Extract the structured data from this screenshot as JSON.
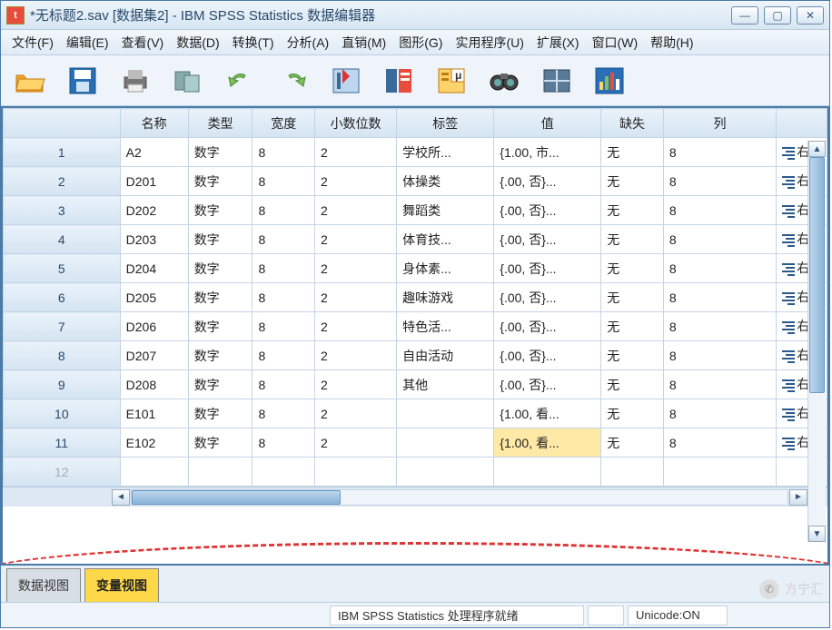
{
  "window": {
    "title": "*无标题2.sav [数据集2] - IBM SPSS Statistics 数据编辑器",
    "min_icon": "—",
    "max_icon": "▢",
    "close_icon": "✕"
  },
  "menu": {
    "file": "文件(F)",
    "edit": "编辑(E)",
    "view": "查看(V)",
    "data": "数据(D)",
    "transform": "转换(T)",
    "analyze": "分析(A)",
    "direct": "直销(M)",
    "graphs": "图形(G)",
    "utilities": "实用程序(U)",
    "extensions": "扩展(X)",
    "window": "窗口(W)",
    "help": "帮助(H)"
  },
  "columns": {
    "name": "名称",
    "type": "类型",
    "width": "宽度",
    "decimals": "小数位数",
    "label": "标签",
    "values": "值",
    "missing": "缺失",
    "col": "列",
    "align": "右"
  },
  "rows": [
    {
      "n": "1",
      "name": "A2",
      "type": "数字",
      "width": "8",
      "dec": "2",
      "label": "学校所...",
      "values": "{1.00, 市...",
      "missing": "无",
      "col": "8",
      "align": "右"
    },
    {
      "n": "2",
      "name": "D201",
      "type": "数字",
      "width": "8",
      "dec": "2",
      "label": "体操类",
      "values": "{.00, 否}...",
      "missing": "无",
      "col": "8",
      "align": "右"
    },
    {
      "n": "3",
      "name": "D202",
      "type": "数字",
      "width": "8",
      "dec": "2",
      "label": "舞蹈类",
      "values": "{.00, 否}...",
      "missing": "无",
      "col": "8",
      "align": "右"
    },
    {
      "n": "4",
      "name": "D203",
      "type": "数字",
      "width": "8",
      "dec": "2",
      "label": "体育技...",
      "values": "{.00, 否}...",
      "missing": "无",
      "col": "8",
      "align": "右"
    },
    {
      "n": "5",
      "name": "D204",
      "type": "数字",
      "width": "8",
      "dec": "2",
      "label": "身体素...",
      "values": "{.00, 否}...",
      "missing": "无",
      "col": "8",
      "align": "右"
    },
    {
      "n": "6",
      "name": "D205",
      "type": "数字",
      "width": "8",
      "dec": "2",
      "label": "趣味游戏",
      "values": "{.00, 否}...",
      "missing": "无",
      "col": "8",
      "align": "右"
    },
    {
      "n": "7",
      "name": "D206",
      "type": "数字",
      "width": "8",
      "dec": "2",
      "label": "特色活...",
      "values": "{.00, 否}...",
      "missing": "无",
      "col": "8",
      "align": "右"
    },
    {
      "n": "8",
      "name": "D207",
      "type": "数字",
      "width": "8",
      "dec": "2",
      "label": "自由活动",
      "values": "{.00, 否}...",
      "missing": "无",
      "col": "8",
      "align": "右"
    },
    {
      "n": "9",
      "name": "D208",
      "type": "数字",
      "width": "8",
      "dec": "2",
      "label": "其他",
      "values": "{.00, 否}...",
      "missing": "无",
      "col": "8",
      "align": "右"
    },
    {
      "n": "10",
      "name": "E101",
      "type": "数字",
      "width": "8",
      "dec": "2",
      "label": "",
      "values": "{1.00, 看...",
      "missing": "无",
      "col": "8",
      "align": "右"
    },
    {
      "n": "11",
      "name": "E102",
      "type": "数字",
      "width": "8",
      "dec": "2",
      "label": "",
      "values": "{1.00, 看...",
      "missing": "无",
      "col": "8",
      "align": "右",
      "hl": true
    }
  ],
  "empty_row": "12",
  "tabs": {
    "data": "数据视图",
    "variable": "变量视图"
  },
  "status": {
    "processor": "IBM SPSS Statistics 处理程序就绪",
    "unicode": "Unicode:ON"
  },
  "watermark": "方宁汇"
}
